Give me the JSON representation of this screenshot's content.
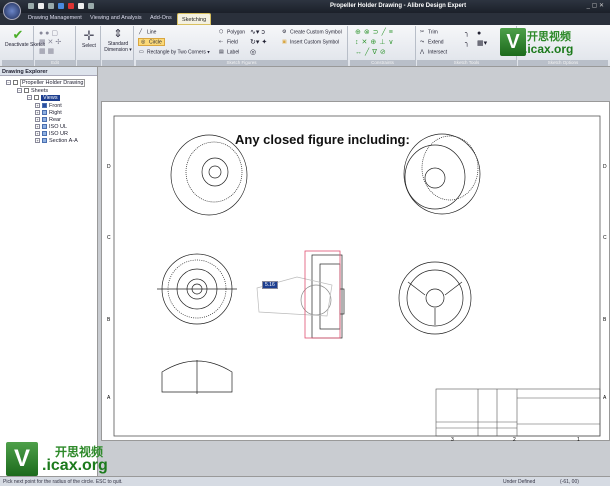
{
  "app": {
    "title": "Propeller Holder Drawing - Alibre Design Expert",
    "window_controls": "_ ▢ ✕"
  },
  "tabs": [
    {
      "label": "Drawing Management"
    },
    {
      "label": "Viewing and Analysis"
    },
    {
      "label": "Add-Ons"
    },
    {
      "label": "Sketching",
      "active": true
    }
  ],
  "ribbon": {
    "deactivate_sketch": "Deactivate Sketch",
    "edit_group": "Edit",
    "select": "Select",
    "standard_dimension": "Standard Dimension ▾",
    "line": "Line",
    "circle": "Circle",
    "rectangle": "Rectangle by Two Corners ▾",
    "polygon": "Polygon",
    "field": "Field",
    "label": "Label",
    "create_custom_symbol": "Create Custom Symbol",
    "insert_custom_symbol": "Insert Custom Symbol",
    "sketch_figures_group": "Sketch Figures",
    "constraints_group": "Constraints",
    "trim": "Trim",
    "extend": "Extend",
    "intersect": "Intersect",
    "sketch_tools_group": "Sketch Tools",
    "sketch_options_group": "Sketch Options"
  },
  "explorer": {
    "title": "Drawing Explorer",
    "root": "Propeller Holder Drawing",
    "sheets": "Sheets",
    "views": "Views",
    "items": [
      "Front",
      "Right",
      "Rear",
      "ISO UL",
      "ISO UR",
      "Section A-A"
    ]
  },
  "drawing": {
    "annotation": "Any closed figure including:",
    "dimension_input": "5.16",
    "zone_rows": [
      "D",
      "C",
      "B",
      "A"
    ],
    "zone_cols": [
      "3",
      "2",
      "1"
    ]
  },
  "status": {
    "message": "Pick next point for the radius of the circle.  ESC to quit.",
    "state": "Under Defined",
    "coords": "(-61, 00)"
  },
  "watermark": {
    "letter": "V",
    "cn": "开思视频",
    "site": ".icax.org"
  },
  "colors": {
    "accent": "#1d3e8f",
    "selection": "#e05070",
    "ribbon_label": "#b9bfc9"
  }
}
